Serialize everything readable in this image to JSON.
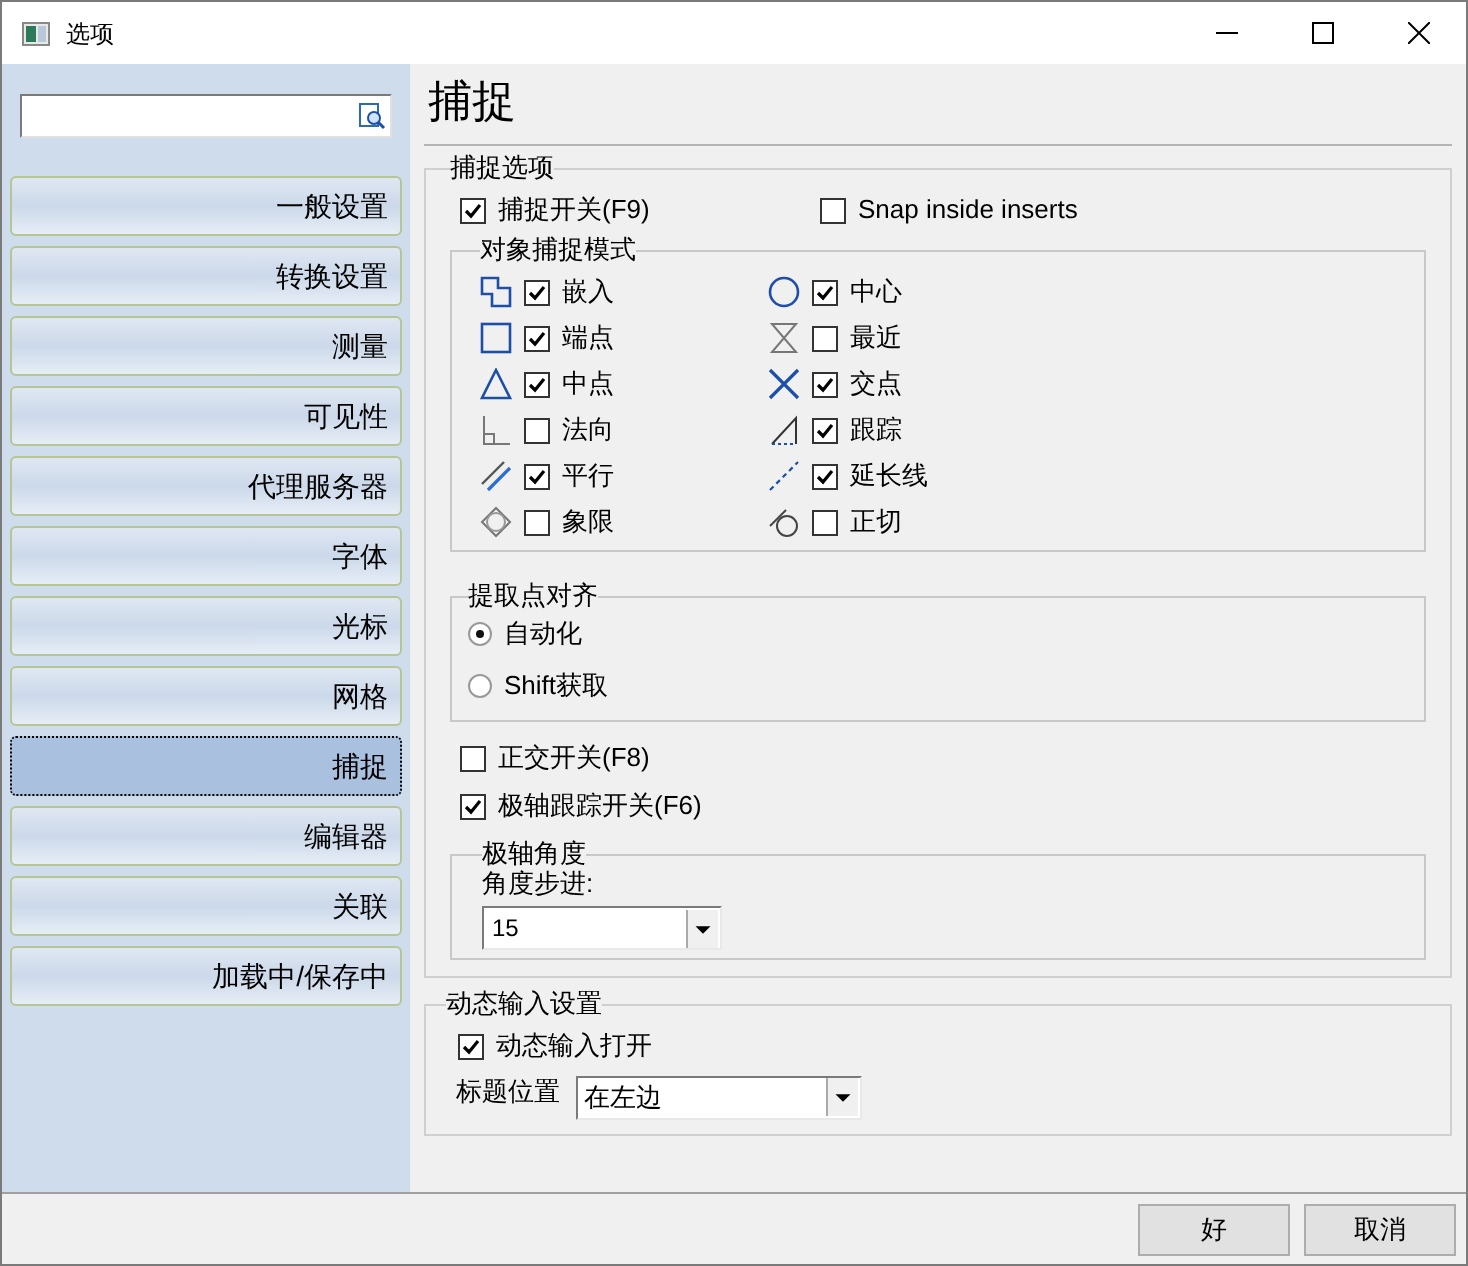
{
  "window": {
    "title": "选项"
  },
  "sidebar": {
    "items": [
      {
        "label": "一般设置",
        "selected": false
      },
      {
        "label": "转换设置",
        "selected": false
      },
      {
        "label": "测量",
        "selected": false
      },
      {
        "label": "可见性",
        "selected": false
      },
      {
        "label": "代理服务器",
        "selected": false
      },
      {
        "label": "字体",
        "selected": false
      },
      {
        "label": "光标",
        "selected": false
      },
      {
        "label": "网格",
        "selected": false
      },
      {
        "label": "捕捉",
        "selected": true
      },
      {
        "label": "编辑器",
        "selected": false
      },
      {
        "label": "关联",
        "selected": false
      },
      {
        "label": "加载中/保存中",
        "selected": false
      }
    ]
  },
  "page_title": "捕捉",
  "snap_options": {
    "title": "捕捉选项",
    "toggles": [
      {
        "label": "捕捉开关(F9)",
        "checked": true
      },
      {
        "label": "Snap inside inserts",
        "checked": false
      }
    ],
    "object_snap": {
      "title": "对象捕捉模式",
      "modes": [
        {
          "label": "嵌入",
          "checked": true
        },
        {
          "label": "中心",
          "checked": true
        },
        {
          "label": "端点",
          "checked": true
        },
        {
          "label": "最近",
          "checked": false
        },
        {
          "label": "中点",
          "checked": true
        },
        {
          "label": "交点",
          "checked": true
        },
        {
          "label": "法向",
          "checked": false
        },
        {
          "label": "跟踪",
          "checked": true
        },
        {
          "label": "平行",
          "checked": true
        },
        {
          "label": "延长线",
          "checked": true
        },
        {
          "label": "象限",
          "checked": false
        },
        {
          "label": "正切",
          "checked": false
        }
      ]
    },
    "pick_alignment": {
      "title": "提取点对齐",
      "options": [
        {
          "label": "自动化",
          "selected": true
        },
        {
          "label": "Shift获取",
          "selected": false
        }
      ]
    },
    "switches": [
      {
        "label": "正交开关(F8)",
        "checked": false
      },
      {
        "label": "极轴跟踪开关(F6)",
        "checked": true
      }
    ],
    "polar_angle": {
      "title": "极轴角度",
      "step_label": "角度步进:",
      "step_value": "15"
    }
  },
  "dynamic_input": {
    "title": "动态输入设置",
    "enable": {
      "label": "动态输入打开",
      "checked": true
    },
    "caption_label": "标题位置",
    "caption_value": "在左边"
  },
  "buttons": [
    "好",
    "取消"
  ]
}
